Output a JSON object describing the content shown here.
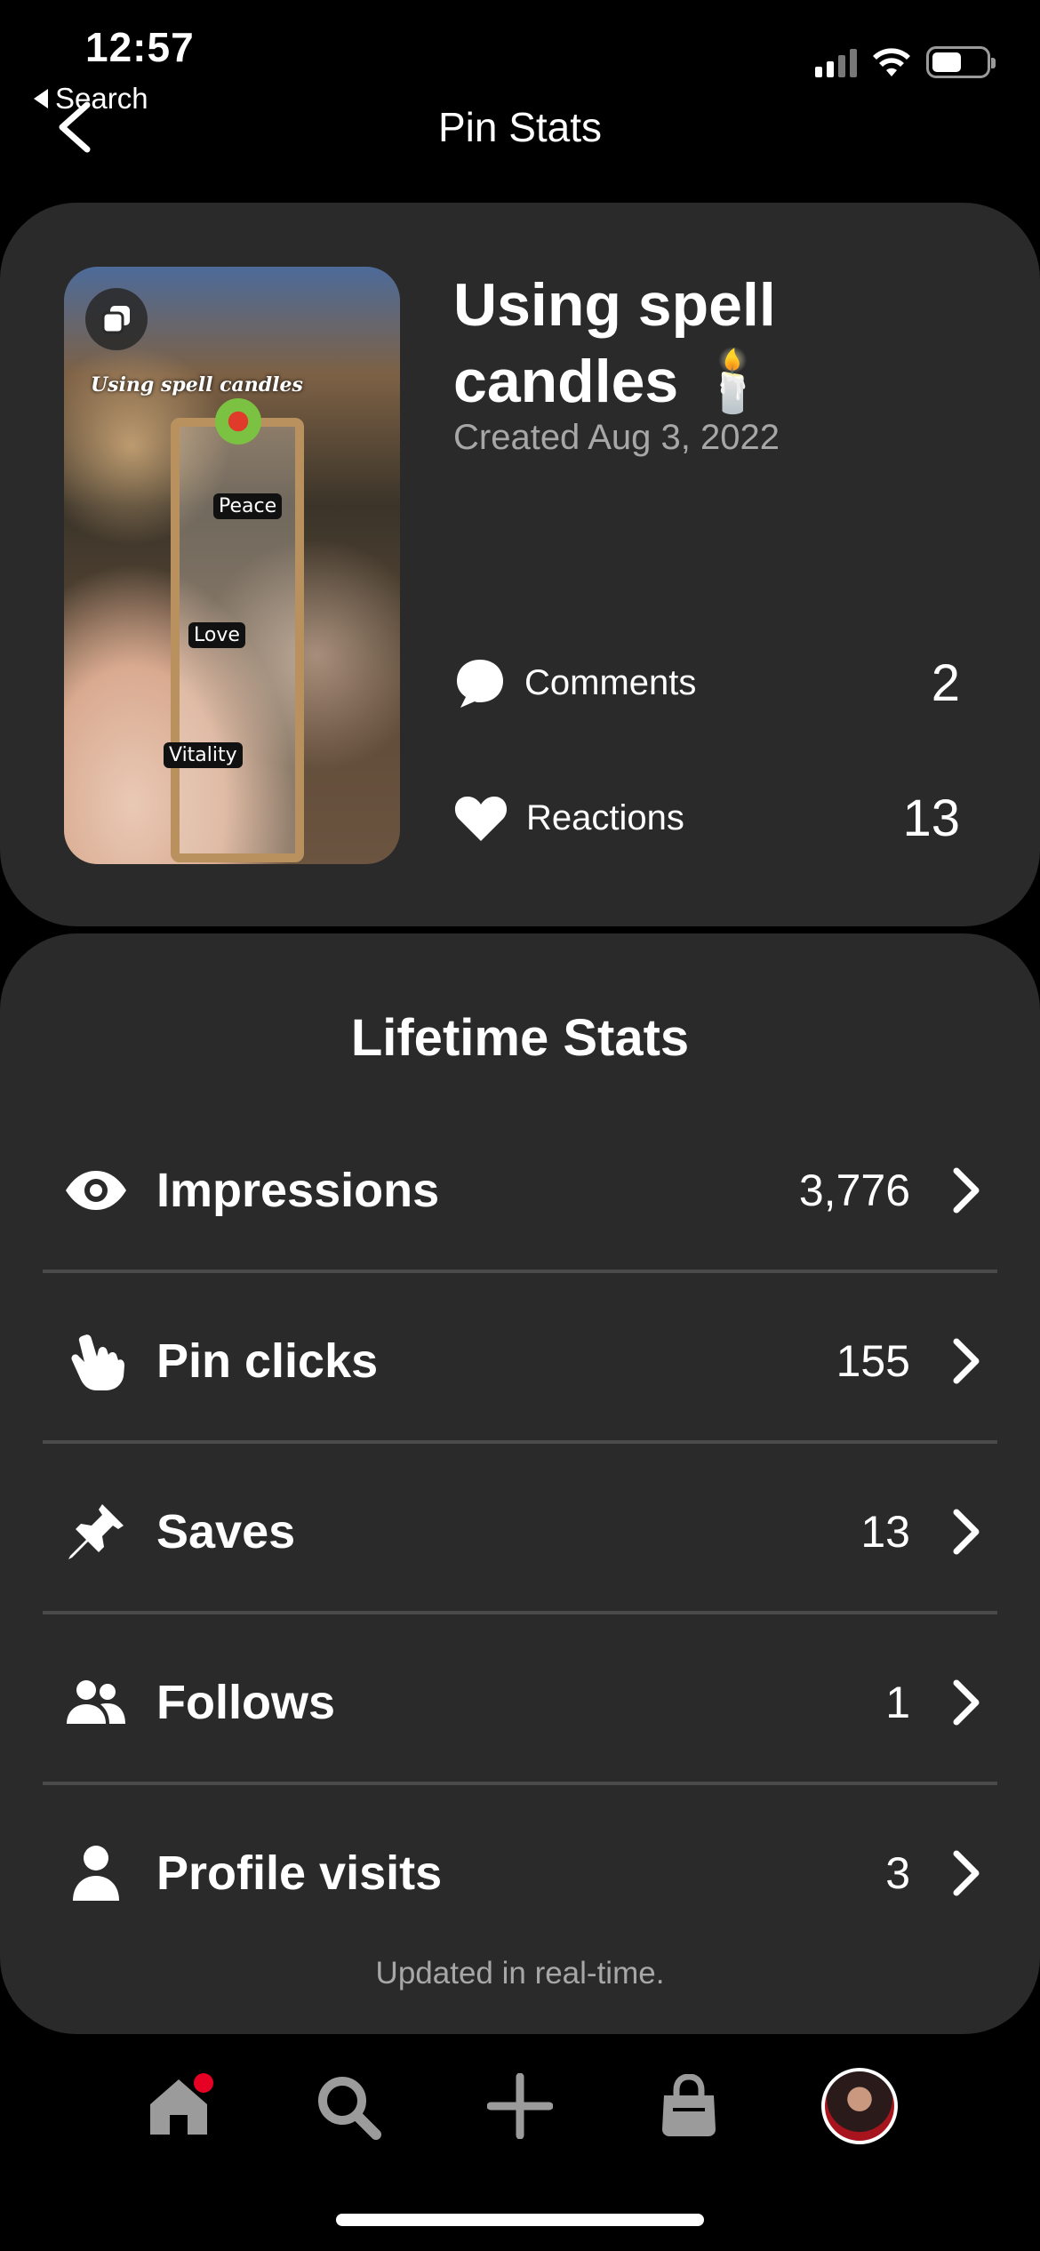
{
  "status_bar": {
    "time": "12:57",
    "back_app": "Search"
  },
  "header": {
    "title": "Pin Stats"
  },
  "pin": {
    "title": "Using spell candles 🕯️",
    "created": "Created Aug 3, 2022",
    "image": {
      "overlay_text": "Using spell candles",
      "tags": [
        "Peace",
        "Love",
        "Vitality"
      ]
    },
    "comments_label": "Comments",
    "comments_count": "2",
    "reactions_label": "Reactions",
    "reactions_count": "13"
  },
  "lifetime": {
    "title": "Lifetime Stats",
    "rows": [
      {
        "label": "Impressions",
        "value": "3,776",
        "icon": "eye-icon"
      },
      {
        "label": "Pin clicks",
        "value": "155",
        "icon": "pointer-hand-icon"
      },
      {
        "label": "Saves",
        "value": "13",
        "icon": "pushpin-icon"
      },
      {
        "label": "Follows",
        "value": "1",
        "icon": "people-icon"
      },
      {
        "label": "Profile visits",
        "value": "3",
        "icon": "person-icon"
      }
    ],
    "footer": "Updated in real-time."
  },
  "tab_bar": {
    "items": [
      "home-icon",
      "search-icon",
      "plus-icon",
      "shopping-bag-icon",
      "profile-avatar"
    ],
    "notification_color": "#e60023"
  }
}
